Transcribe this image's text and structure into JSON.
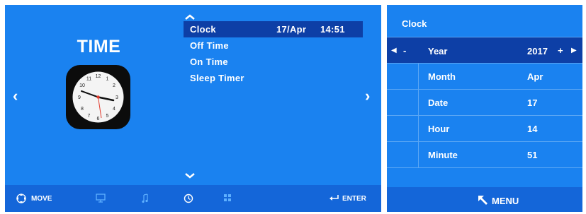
{
  "left_panel": {
    "title": "TIME",
    "nav_left": "‹",
    "nav_right": "›",
    "menu": [
      {
        "label": "Clock",
        "date": "17/Apr",
        "time": "14:51",
        "selected": true
      },
      {
        "label": "Off Time"
      },
      {
        "label": "On Time"
      },
      {
        "label": "Sleep Timer"
      }
    ],
    "bottom_bar": {
      "move_label": "MOVE",
      "enter_label": "ENTER",
      "icons": [
        "monitor-icon",
        "music-note-icon",
        "clock-icon",
        "grid-icon"
      ],
      "active_icon": "clock-icon"
    }
  },
  "right_panel": {
    "title": "Clock",
    "rows": [
      {
        "label": "Year",
        "value": "2017",
        "selected": true,
        "minus": "-",
        "plus": "+"
      },
      {
        "label": "Month",
        "value": "Apr"
      },
      {
        "label": "Date",
        "value": "17"
      },
      {
        "label": "Hour",
        "value": "14"
      },
      {
        "label": "Minute",
        "value": "51"
      }
    ],
    "menu_label": "MENU"
  },
  "colors": {
    "panel_blue": "#1a82f0",
    "selected_blue": "#0d3fa6",
    "bar_blue": "#1466d9",
    "divider": "#5aa6f4"
  }
}
